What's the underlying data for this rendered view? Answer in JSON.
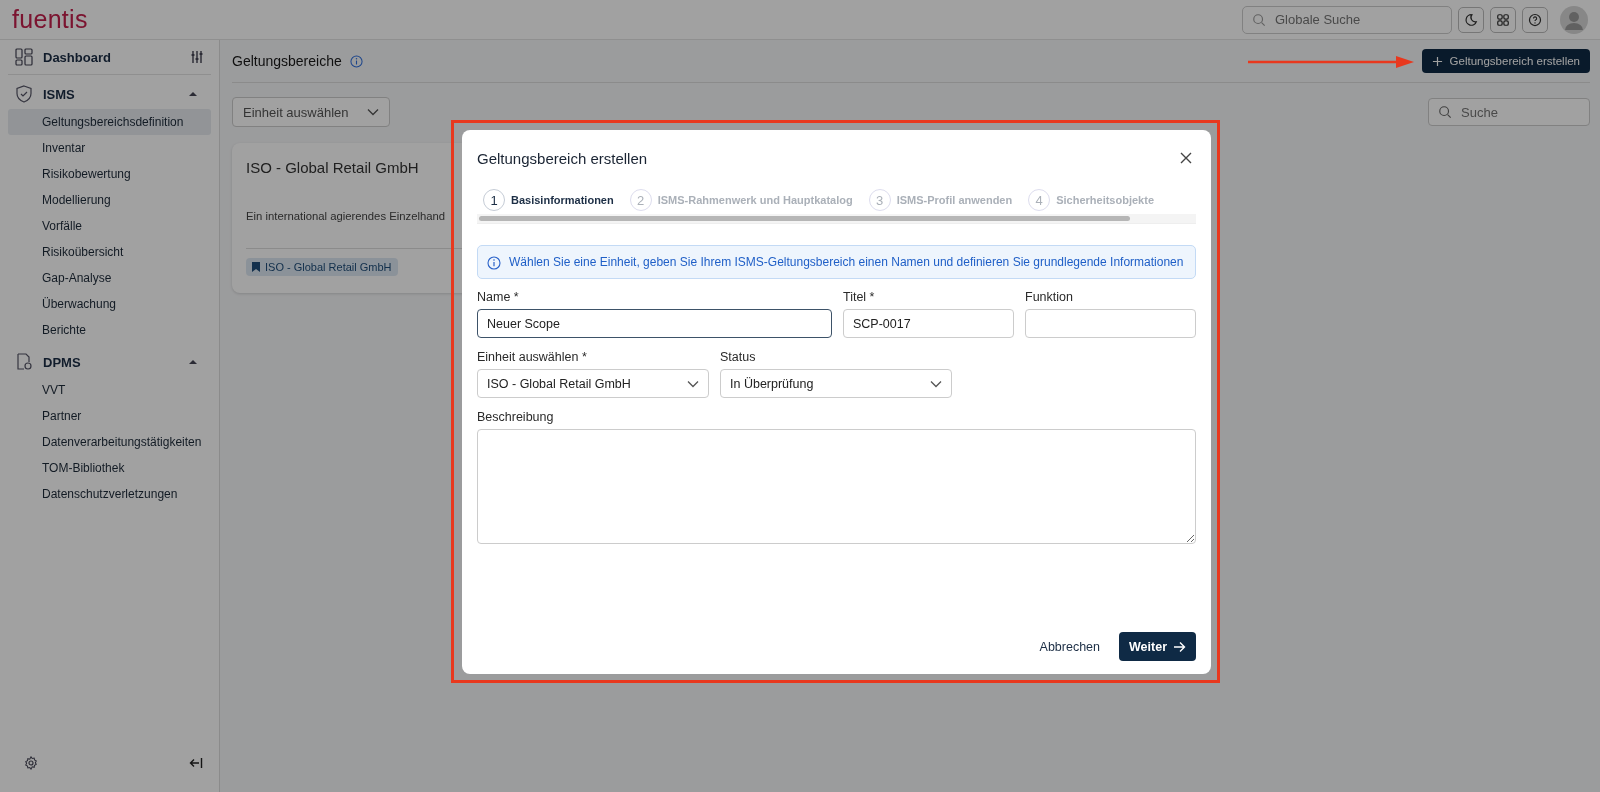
{
  "app": {
    "logo": "fuentis"
  },
  "header": {
    "search": {
      "placeholder": "Globale Suche"
    }
  },
  "sidebar": {
    "dashboard": {
      "label": "Dashboard"
    },
    "sections": [
      {
        "label": "ISMS",
        "expanded": true,
        "items": [
          {
            "label": "Geltungsbereichsdefinition",
            "selected": true
          },
          {
            "label": "Inventar",
            "selected": false
          },
          {
            "label": "Risikobewertung",
            "selected": false
          },
          {
            "label": "Modellierung",
            "selected": false
          },
          {
            "label": "Vorfälle",
            "selected": false
          },
          {
            "label": "Risikoübersicht",
            "selected": false
          },
          {
            "label": "Gap-Analyse",
            "selected": false
          },
          {
            "label": "Überwachung",
            "selected": false
          },
          {
            "label": "Berichte",
            "selected": false
          }
        ]
      },
      {
        "label": "DPMS",
        "expanded": true,
        "items": [
          {
            "label": "VVT",
            "selected": false
          },
          {
            "label": "Partner",
            "selected": false
          },
          {
            "label": "Datenverarbeitungstätigkeiten",
            "selected": false
          },
          {
            "label": "TOM-Bibliothek",
            "selected": false
          },
          {
            "label": "Datenschutzverletzungen",
            "selected": false
          }
        ]
      }
    ]
  },
  "page": {
    "title": "Geltungsbereiche",
    "create_button": "Geltungsbereich erstellen",
    "unit_filter": "Einheit auswählen",
    "search": {
      "placeholder": "Suche"
    },
    "cards": [
      {
        "title": "ISO - Global Retail GmbH",
        "description": "Ein international agierendes Einzelhand",
        "tag": "ISO - Global Retail GmbH"
      }
    ]
  },
  "dialog": {
    "title": "Geltungsbereich erstellen",
    "steps": [
      {
        "number": "1",
        "label": "Basisinformationen",
        "selected": true
      },
      {
        "number": "2",
        "label": "ISMS-Rahmenwerk und Hauptkatalog",
        "selected": false
      },
      {
        "number": "3",
        "label": "ISMS-Profil anwenden",
        "selected": false
      },
      {
        "number": "4",
        "label": "Sicherheitsobjekte",
        "selected": false
      }
    ],
    "info": "Wählen Sie eine Einheit, geben Sie Ihrem ISMS-Geltungsbereich einen Namen und definieren Sie grundlegende Informationen",
    "rows": [
      [
        {
          "kind": "text",
          "label": "Name *",
          "value": "Neuer Scope",
          "focused": true
        },
        {
          "kind": "text",
          "label": "Titel *",
          "value": "SCP-0017",
          "focused": false
        },
        {
          "kind": "text",
          "label": "Funktion",
          "focused": false
        }
      ],
      [
        {
          "kind": "select",
          "label": "Einheit auswählen *",
          "value": "ISO - Global Retail GmbH",
          "focused": false
        },
        {
          "kind": "select",
          "label": "Status",
          "value": "In Überprüfung",
          "focused": false
        }
      ],
      [
        {
          "kind": "textarea",
          "label": "Beschreibung",
          "focused": false
        }
      ]
    ],
    "cancel_button": "Abbrechen",
    "next_button": "Weiter"
  }
}
